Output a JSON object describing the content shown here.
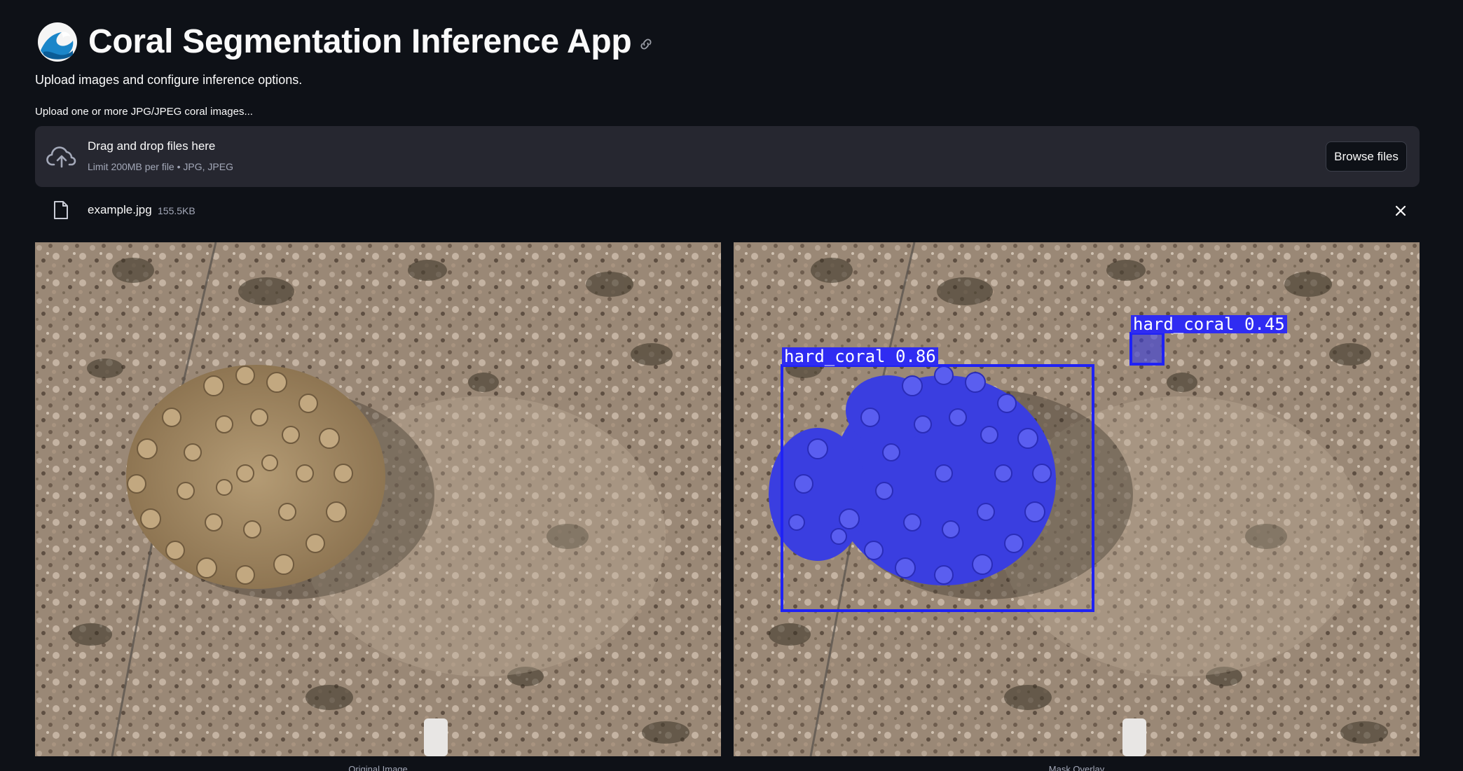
{
  "header": {
    "title": "Coral Segmentation Inference App",
    "subtitle": "Upload images and configure inference options."
  },
  "uploader": {
    "label": "Upload one or more JPG/JPEG coral images...",
    "drop_text": "Drag and drop files here",
    "limit_text": "Limit 200MB per file • JPG, JPEG",
    "browse_label": "Browse files"
  },
  "file": {
    "name": "example.jpg",
    "size": "155.5KB"
  },
  "images": {
    "left_caption": "Original Image",
    "right_caption": "Mask Overlay"
  },
  "detections": [
    {
      "label": "hard_coral 0.86"
    },
    {
      "label": "hard_coral 0.45"
    }
  ],
  "colors": {
    "background": "#0e1117",
    "panel": "#262730",
    "mask": "#3a3ee0",
    "box": "#1f22f5"
  },
  "icons": {
    "logo": "wave-icon",
    "anchor": "link-icon",
    "upload": "cloud-upload-icon",
    "file": "file-icon",
    "remove": "close-icon"
  }
}
